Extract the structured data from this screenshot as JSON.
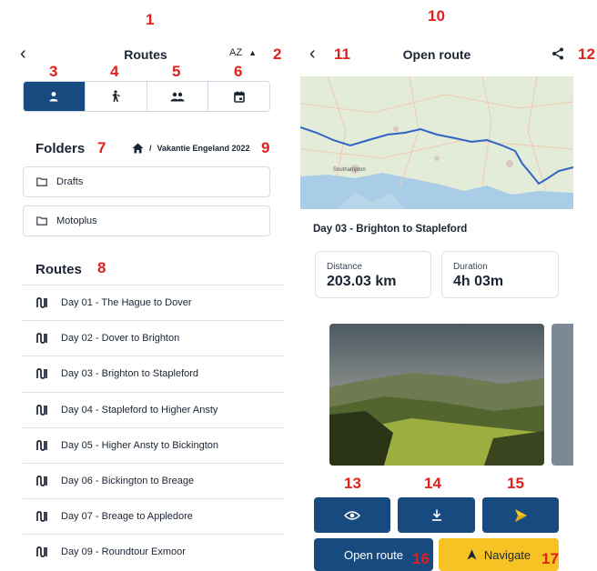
{
  "markers": [
    "1",
    "2",
    "3",
    "4",
    "5",
    "6",
    "7",
    "8",
    "9",
    "10",
    "11",
    "12",
    "13",
    "14",
    "15",
    "16",
    "17"
  ],
  "routes_screen": {
    "title": "Routes",
    "sort_label": "AZ",
    "sort_arrow": "▲",
    "tabs": [
      {
        "icon": "person-icon",
        "active": true
      },
      {
        "icon": "walker-icon",
        "active": false
      },
      {
        "icon": "group-icon",
        "active": false
      },
      {
        "icon": "calendar-icon",
        "active": false
      }
    ],
    "folders_heading": "Folders",
    "breadcrumb": "Vakantie Engeland 2022",
    "breadcrumb_sep": "/",
    "folders": [
      "Drafts",
      "Motoplus"
    ],
    "routes_heading": "Routes",
    "routes": [
      "Day 01 - The Hague to Dover",
      "Day 02 - Dover to Brighton",
      "Day 03 - Brighton to Stapleford",
      "Day 04 - Stapleford to Higher Ansty",
      "Day 05 - Higher Ansty to Bickington",
      "Day 06 - Bickington to Breage",
      "Day 07 - Breage to Appledore",
      "Day 09 - Roundtour Exmoor"
    ]
  },
  "open_route_screen": {
    "title": "Open route",
    "route_name": "Day 03 - Brighton to Stapleford",
    "distance_label": "Distance",
    "distance_value": "203.03 km",
    "duration_label": "Duration",
    "duration_value": "4h 03m",
    "map_labels": [
      "Southampton"
    ],
    "open_button": "Open route",
    "navigate_button": "Navigate",
    "colors": {
      "primary": "#174a7e",
      "accent": "#f7c324",
      "route_line": "#2f63c4"
    }
  }
}
